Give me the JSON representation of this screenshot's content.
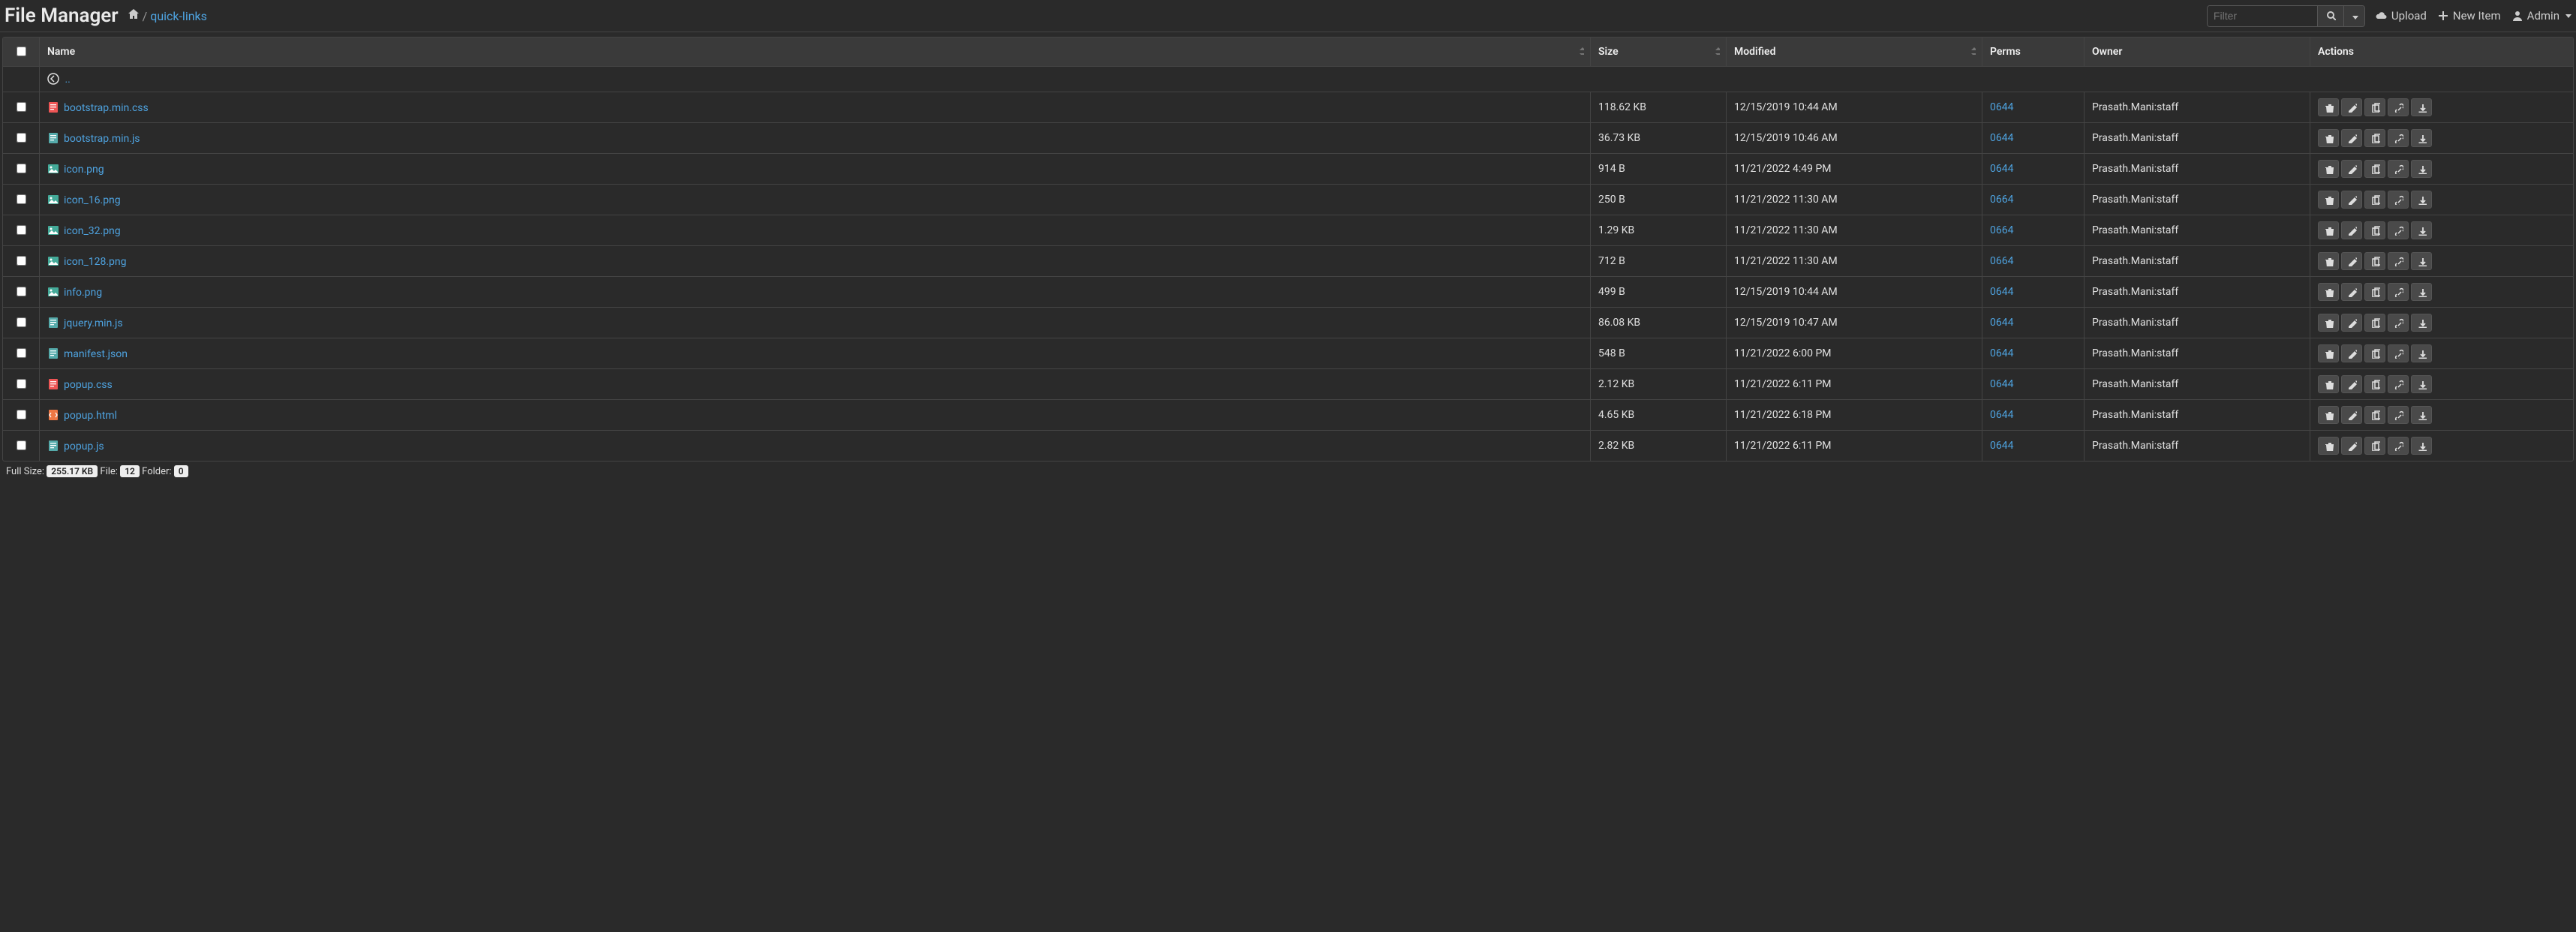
{
  "app_title": "File Manager",
  "breadcrumb": {
    "sep": "/",
    "current": "quick-links"
  },
  "search": {
    "placeholder": "Filter"
  },
  "top_links": {
    "upload": "Upload",
    "new_item": "New Item",
    "admin": "Admin"
  },
  "columns": {
    "name": "Name",
    "size": "Size",
    "modified": "Modified",
    "perms": "Perms",
    "owner": "Owner",
    "actions": "Actions"
  },
  "parent_link": "..",
  "files": [
    {
      "name": "bootstrap.min.css",
      "icon": "css",
      "size": "118.62 KB",
      "modified": "12/15/2019 10:44 AM",
      "perms": "0644",
      "owner": "Prasath.Mani:staff"
    },
    {
      "name": "bootstrap.min.js",
      "icon": "js",
      "size": "36.73 KB",
      "modified": "12/15/2019 10:46 AM",
      "perms": "0644",
      "owner": "Prasath.Mani:staff"
    },
    {
      "name": "icon.png",
      "icon": "img",
      "size": "914 B",
      "modified": "11/21/2022 4:49 PM",
      "perms": "0644",
      "owner": "Prasath.Mani:staff"
    },
    {
      "name": "icon_16.png",
      "icon": "img",
      "size": "250 B",
      "modified": "11/21/2022 11:30 AM",
      "perms": "0664",
      "owner": "Prasath.Mani:staff"
    },
    {
      "name": "icon_32.png",
      "icon": "img",
      "size": "1.29 KB",
      "modified": "11/21/2022 11:30 AM",
      "perms": "0664",
      "owner": "Prasath.Mani:staff"
    },
    {
      "name": "icon_128.png",
      "icon": "img",
      "size": "712 B",
      "modified": "11/21/2022 11:30 AM",
      "perms": "0664",
      "owner": "Prasath.Mani:staff"
    },
    {
      "name": "info.png",
      "icon": "img",
      "size": "499 B",
      "modified": "12/15/2019 10:44 AM",
      "perms": "0644",
      "owner": "Prasath.Mani:staff"
    },
    {
      "name": "jquery.min.js",
      "icon": "js",
      "size": "86.08 KB",
      "modified": "12/15/2019 10:47 AM",
      "perms": "0644",
      "owner": "Prasath.Mani:staff"
    },
    {
      "name": "manifest.json",
      "icon": "js",
      "size": "548 B",
      "modified": "11/21/2022 6:00 PM",
      "perms": "0644",
      "owner": "Prasath.Mani:staff"
    },
    {
      "name": "popup.css",
      "icon": "css",
      "size": "2.12 KB",
      "modified": "11/21/2022 6:11 PM",
      "perms": "0644",
      "owner": "Prasath.Mani:staff"
    },
    {
      "name": "popup.html",
      "icon": "html",
      "size": "4.65 KB",
      "modified": "11/21/2022 6:18 PM",
      "perms": "0644",
      "owner": "Prasath.Mani:staff"
    },
    {
      "name": "popup.js",
      "icon": "js",
      "size": "2.82 KB",
      "modified": "11/21/2022 6:11 PM",
      "perms": "0644",
      "owner": "Prasath.Mani:staff"
    }
  ],
  "footer": {
    "full_size_label": "Full Size:",
    "full_size_value": "255.17 KB",
    "file_label": "File:",
    "file_value": "12",
    "folder_label": "Folder:",
    "folder_value": "0"
  }
}
